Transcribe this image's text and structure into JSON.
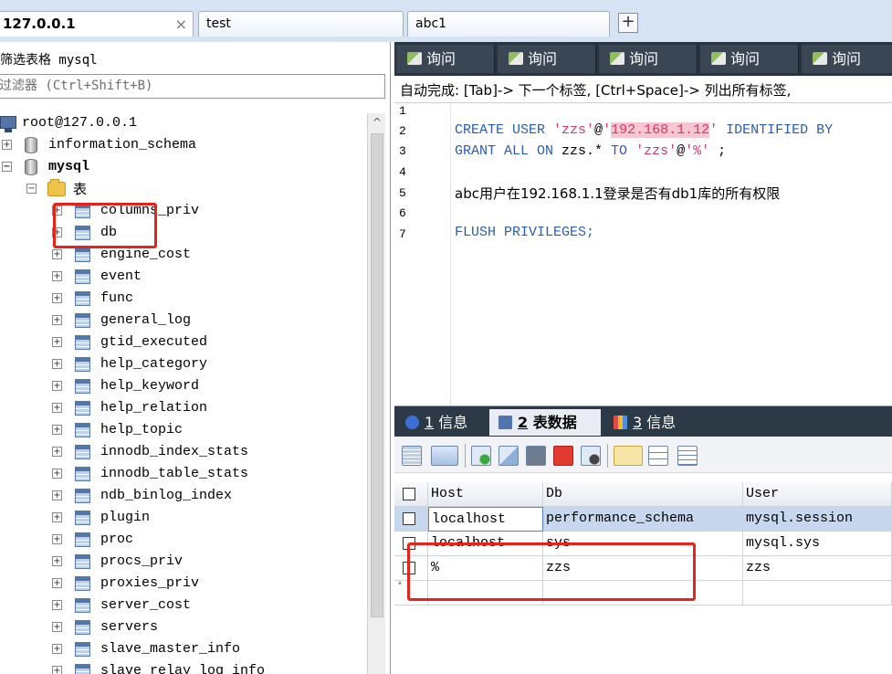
{
  "connection_tabs": [
    {
      "label": "127.0.0.1",
      "active": true
    },
    {
      "label": "test",
      "active": false
    },
    {
      "label": "abc1",
      "active": false
    }
  ],
  "tab_close_glyph": "×",
  "tab_add_glyph": "+",
  "filter": {
    "label": "筛选表格 mysql",
    "placeholder": "过滤器 (Ctrl+Shift+B)"
  },
  "tree": {
    "root": "root@127.0.0.1",
    "databases": [
      "information_schema",
      "mysql"
    ],
    "folder": "表",
    "tables": [
      "columns_priv",
      "db",
      "engine_cost",
      "event",
      "func",
      "general_log",
      "gtid_executed",
      "help_category",
      "help_keyword",
      "help_relation",
      "help_topic",
      "innodb_index_stats",
      "innodb_table_stats",
      "ndb_binlog_index",
      "plugin",
      "proc",
      "procs_priv",
      "proxies_priv",
      "server_cost",
      "servers",
      "slave_master_info",
      "slave_relay_log_info"
    ],
    "expand_glyph": "+",
    "collapse_glyph": "−"
  },
  "scroll_up_glyph": "^",
  "query_tabs": [
    "询问",
    "询问",
    "询问",
    "询问",
    "询问"
  ],
  "autocomplete_hint": "自动完成: [Tab]-> 下一个标签, [Ctrl+Space]-> 列出所有标签,",
  "editor": {
    "line_numbers": [
      "1",
      "2",
      "3",
      "4",
      "5",
      "6",
      "7"
    ],
    "line2": {
      "kw1": "CREATE USER ",
      "s1": "'zzs'",
      "at": "@",
      "q1": "'",
      "host": "192.168.1.12",
      "q2": "'",
      "rest": " IDENTIFIED BY"
    },
    "line3": {
      "kw1": "GRANT ALL ON ",
      "plain": "zzs.* ",
      "kw2": "TO ",
      "s1": "'zzs'",
      "at": "@",
      "s2": "'%'",
      "end": " ;"
    },
    "line5": "abc用户在192.168.1.1登录是否有db1库的所有权限",
    "line7": "FLUSH PRIVILEGES;"
  },
  "result_tabs": [
    {
      "num": "1",
      "label": " 信息",
      "active": false
    },
    {
      "num": "2",
      "label": " 表数据",
      "active": true
    },
    {
      "num": "3",
      "label": " 信息",
      "active": false
    }
  ],
  "grid": {
    "columns": [
      "Host",
      "Db",
      "User"
    ],
    "rows": [
      [
        "localhost",
        "performance_schema",
        "mysql.session"
      ],
      [
        "localhost",
        "sys",
        "mysql.sys"
      ],
      [
        "%",
        "zzs",
        "zzs"
      ]
    ],
    "new_row_marker": "*"
  },
  "colors": {
    "annotation_red": "#e8221b",
    "sql_keyword": "#2a5db0",
    "sql_string": "#d23a6b"
  }
}
